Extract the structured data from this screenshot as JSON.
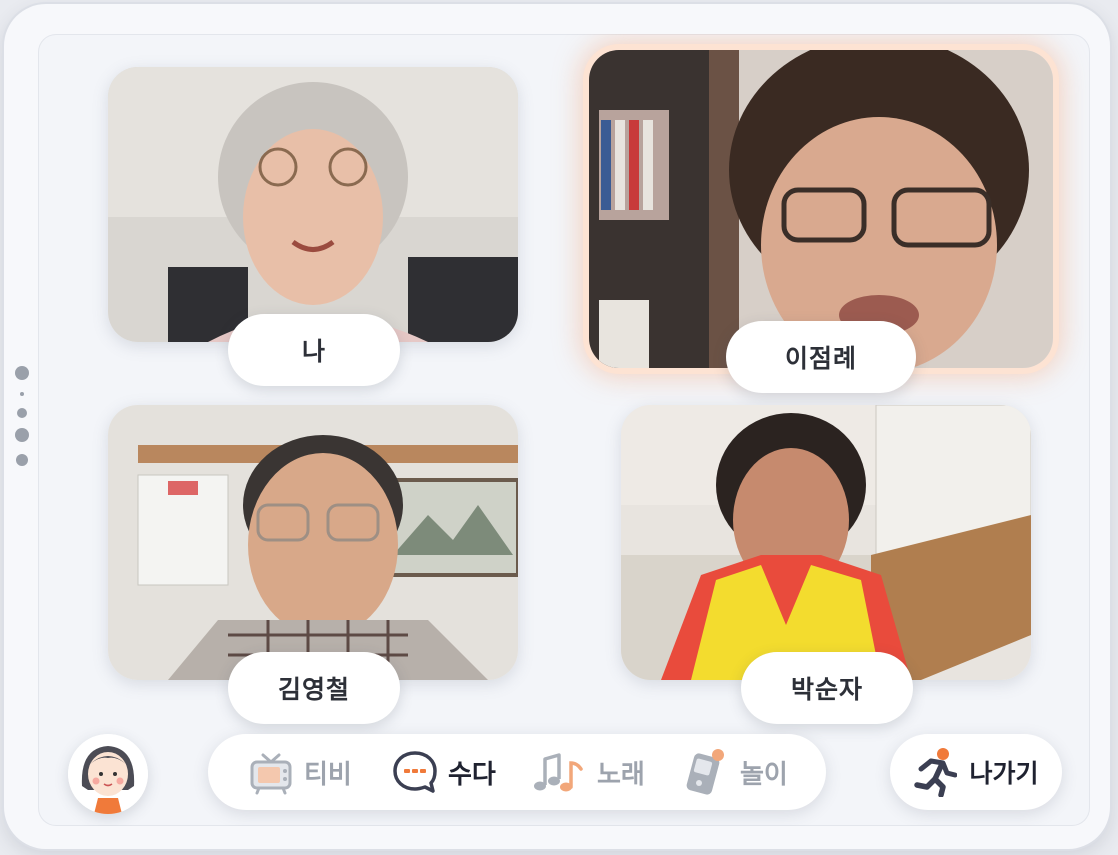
{
  "participants": [
    {
      "name": "나",
      "active": false
    },
    {
      "name": "이점례",
      "active": true
    },
    {
      "name": "김영철",
      "active": false
    },
    {
      "name": "박순자",
      "active": false
    }
  ],
  "nav": {
    "items": [
      {
        "label": "티비",
        "icon": "tv-icon",
        "active": false
      },
      {
        "label": "수다",
        "icon": "chat-bubble-icon",
        "active": true
      },
      {
        "label": "노래",
        "icon": "music-note-icon",
        "active": false
      },
      {
        "label": "놀이",
        "icon": "game-icon",
        "active": false
      }
    ]
  },
  "exit": {
    "label": "나가기",
    "icon": "running-person-icon"
  },
  "colors": {
    "accent": "#f07a3a",
    "active_text": "#1f2230",
    "inactive_text": "#9da3ad",
    "active_glow": "#fde3d3"
  }
}
